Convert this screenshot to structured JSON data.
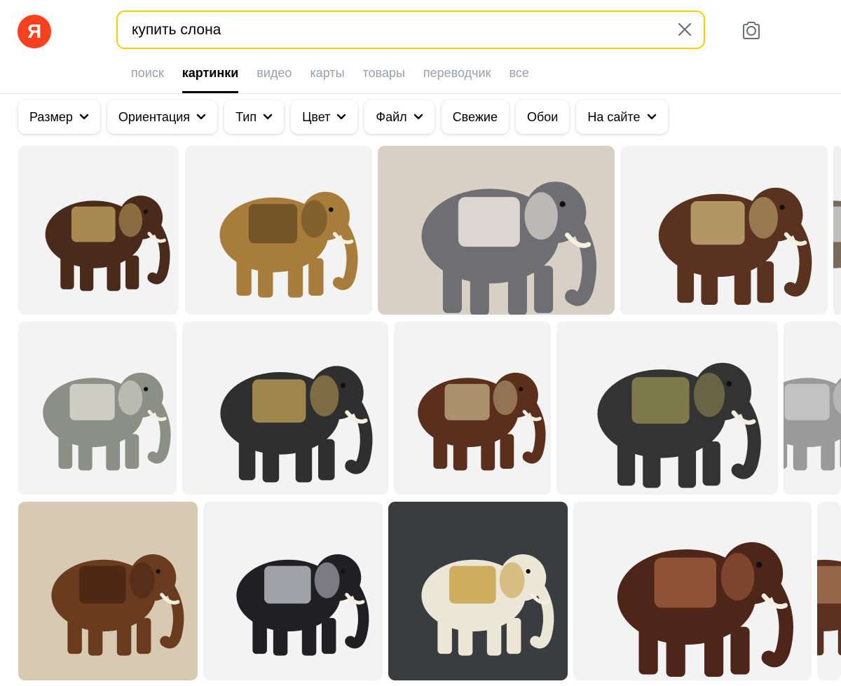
{
  "logo": {
    "letter": "Я"
  },
  "search": {
    "query": "купить слона"
  },
  "tabs": [
    {
      "label": "поиск",
      "active": false
    },
    {
      "label": "картинки",
      "active": true
    },
    {
      "label": "видео",
      "active": false
    },
    {
      "label": "карты",
      "active": false
    },
    {
      "label": "товары",
      "active": false
    },
    {
      "label": "переводчик",
      "active": false
    },
    {
      "label": "все",
      "active": false
    }
  ],
  "filters": [
    {
      "label": "Размер",
      "dropdown": true
    },
    {
      "label": "Ориентация",
      "dropdown": true
    },
    {
      "label": "Тип",
      "dropdown": true
    },
    {
      "label": "Цвет",
      "dropdown": true
    },
    {
      "label": "Файл",
      "dropdown": true
    },
    {
      "label": "Свежие",
      "dropdown": false
    },
    {
      "label": "Обои",
      "dropdown": false
    },
    {
      "label": "На сайте",
      "dropdown": true
    }
  ],
  "colors": {
    "accent": "#ffcc00",
    "brand": "#fc3f1d",
    "tab_inactive": "#9aa0a9"
  },
  "images": [
    {
      "subject": "brown elephant figurine with mirror saddle",
      "bg": "#f3f3f3",
      "body": "#4a2a1a",
      "trim": "#b89a5a"
    },
    {
      "subject": "golden elephant figurine",
      "bg": "#f3f3f3",
      "body": "#a87d3c",
      "trim": "#6b4e23"
    },
    {
      "subject": "baby elephant on sofa",
      "bg": "#d9d0c5",
      "body": "#6f6f73",
      "trim": "#efe9e2"
    },
    {
      "subject": "brown elephant figurine with calf",
      "bg": "#f3f3f3",
      "body": "#5a3320",
      "trim": "#c2a872"
    },
    {
      "subject": "elephant partially visible",
      "bg": "#f0f0f0",
      "body": "#7a6a5a",
      "trim": "#cccccc"
    },
    {
      "subject": "grey elephant sitting with flower",
      "bg": "#f3f3f3",
      "body": "#8b8f86",
      "trim": "#d8d8cf"
    },
    {
      "subject": "black elephant with jeweled saddle",
      "bg": "#f3f3f3",
      "body": "#2f2f2f",
      "trim": "#b39552"
    },
    {
      "subject": "brown elephant with mirror saddle",
      "bg": "#f3f3f3",
      "body": "#5a2f1c",
      "trim": "#b8a27a"
    },
    {
      "subject": "black elephant with jeweled saddle",
      "bg": "#f3f3f3",
      "body": "#333333",
      "trim": "#8c8650"
    },
    {
      "subject": "silver elephant trunk partially visible",
      "bg": "#f3f3f3",
      "body": "#9a9a9a",
      "trim": "#c9c9c9"
    },
    {
      "subject": "carved wooden elephant",
      "bg": "#d8c9b2",
      "body": "#6b3b1f",
      "trim": "#4a2612"
    },
    {
      "subject": "black and silver elephant",
      "bg": "#f3f3f3",
      "body": "#1f1f24",
      "trim": "#b9b9bf"
    },
    {
      "subject": "white elephant stool",
      "bg": "#3a3d40",
      "body": "#ece6d7",
      "trim": "#c9a24a"
    },
    {
      "subject": "brown elephant stool with red saddle",
      "bg": "#f3f3f3",
      "body": "#4e2519",
      "trim": "#9c5a3c"
    },
    {
      "subject": "elephant partially visible",
      "bg": "#f3f3f3",
      "body": "#5a3020",
      "trim": "#a07050"
    }
  ]
}
